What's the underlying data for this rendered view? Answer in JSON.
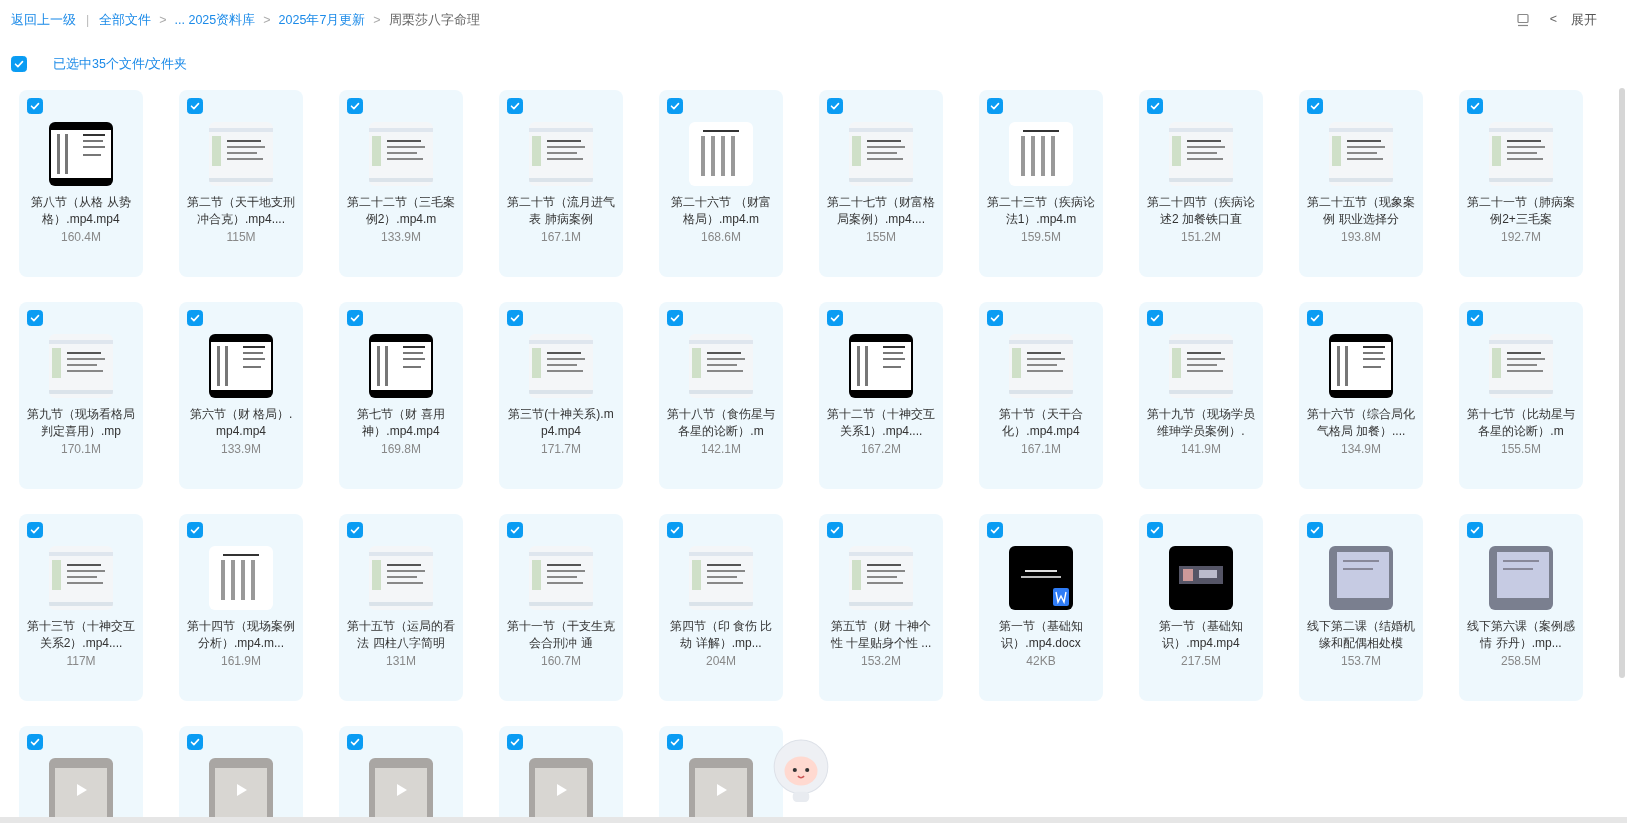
{
  "breadcrumb": {
    "back": "返回上一级",
    "separator": "|",
    "items": [
      {
        "label": "全部文件",
        "arrow": ">"
      },
      {
        "label": "... 2025资料库",
        "arrow": ">"
      },
      {
        "label": "2025年7月更新",
        "arrow": ">"
      },
      {
        "label": "周栗莎八字命理"
      }
    ]
  },
  "toolbar": {
    "collapse_label": "展开",
    "chevron": "<"
  },
  "selection": {
    "checked": true,
    "label": "已选中35个文件/文件夹"
  },
  "files": [
    {
      "name": "第八节（从格 从势格）.mp4.mp4",
      "size": "160.4M",
      "checked": true,
      "kind": "dark"
    },
    {
      "name": "第二节（天干地支刑冲合克）.mp4....",
      "size": "115M",
      "checked": true,
      "kind": "screenshot"
    },
    {
      "name": "第二十二节（三毛案例2）.mp4.m",
      "size": "133.9M",
      "checked": true,
      "kind": "screenshot"
    },
    {
      "name": "第二十节（流月进气表 肺病案例",
      "size": "167.1M",
      "checked": true,
      "kind": "screenshot"
    },
    {
      "name": "第二十六节 （财富格局）.mp4.m",
      "size": "168.6M",
      "checked": true,
      "kind": "page"
    },
    {
      "name": "第二十七节（财富格局案例）.mp4....",
      "size": "155M",
      "checked": true,
      "kind": "screenshot"
    },
    {
      "name": "第二十三节（疾病论法1）.mp4.m",
      "size": "159.5M",
      "checked": true,
      "kind": "page"
    },
    {
      "name": "第二十四节（疾病论述2 加餐铁口直",
      "size": "151.2M",
      "checked": true,
      "kind": "screenshot"
    },
    {
      "name": "第二十五节（现象案例 职业选择分",
      "size": "193.8M",
      "checked": true,
      "kind": "screenshot"
    },
    {
      "name": "第二十一节（肺病案例2+三毛案",
      "size": "192.7M",
      "checked": true,
      "kind": "screenshot"
    },
    {
      "name": "第九节（现场看格局判定喜用）.mp",
      "size": "170.1M",
      "checked": true,
      "kind": "screenshot"
    },
    {
      "name": "第六节（财 格局）.mp4.mp4",
      "size": "133.9M",
      "checked": true,
      "kind": "dark"
    },
    {
      "name": "第七节（财 喜用神）.mp4.mp4",
      "size": "169.8M",
      "checked": true,
      "kind": "dark"
    },
    {
      "name": "第三节(十神关系).mp4.mp4",
      "size": "171.7M",
      "checked": true,
      "kind": "screenshot"
    },
    {
      "name": "第十八节（食伤星与各星的论断）.m",
      "size": "142.1M",
      "checked": true,
      "kind": "screenshot"
    },
    {
      "name": "第十二节（十神交互关系1）.mp4....",
      "size": "167.2M",
      "checked": true,
      "kind": "dark"
    },
    {
      "name": "第十节（天干合化）.mp4.mp4",
      "size": "167.1M",
      "checked": true,
      "kind": "screenshot"
    },
    {
      "name": "第十九节（现场学员维珅学员案例）.",
      "size": "141.9M",
      "checked": true,
      "kind": "screenshot"
    },
    {
      "name": "第十六节（综合局化气格局 加餐）....",
      "size": "134.9M",
      "checked": true,
      "kind": "dark"
    },
    {
      "name": "第十七节（比劫星与各星的论断）.m",
      "size": "155.5M",
      "checked": true,
      "kind": "screenshot"
    },
    {
      "name": "第十三节（十神交互关系2）.mp4....",
      "size": "117M",
      "checked": true,
      "kind": "screenshot"
    },
    {
      "name": "第十四节（现场案例分析）.mp4.m...",
      "size": "161.9M",
      "checked": true,
      "kind": "page"
    },
    {
      "name": "第十五节（运局的看法 四柱八字简明",
      "size": "131M",
      "checked": true,
      "kind": "screenshot"
    },
    {
      "name": "第十一节（干支生克会合刑冲 通",
      "size": "160.7M",
      "checked": true,
      "kind": "screenshot"
    },
    {
      "name": "第四节（印 食伤 比劫 详解）.mp...",
      "size": "204M",
      "checked": true,
      "kind": "screenshot"
    },
    {
      "name": "第五节（财 十神个性 十星贴身个性 ...",
      "size": "153.2M",
      "checked": true,
      "kind": "screenshot"
    },
    {
      "name": "第一节（基础知识）.mp4.docx",
      "size": "42KB",
      "checked": true,
      "kind": "word"
    },
    {
      "name": "第一节（基础知识）.mp4.mp4",
      "size": "217.5M",
      "checked": true,
      "kind": "black-video"
    },
    {
      "name": "线下第二课（结婚机缘和配偶相处模",
      "size": "153.7M",
      "checked": true,
      "kind": "photo"
    },
    {
      "name": "线下第六课（案例感情 乔丹）.mp...",
      "size": "258.5M",
      "checked": true,
      "kind": "photo"
    },
    {
      "checked": true,
      "kind": "photo-video"
    },
    {
      "checked": true,
      "kind": "photo-video"
    },
    {
      "checked": true,
      "kind": "photo-video"
    },
    {
      "checked": true,
      "kind": "photo-video"
    },
    {
      "checked": true,
      "kind": "photo-video"
    }
  ]
}
